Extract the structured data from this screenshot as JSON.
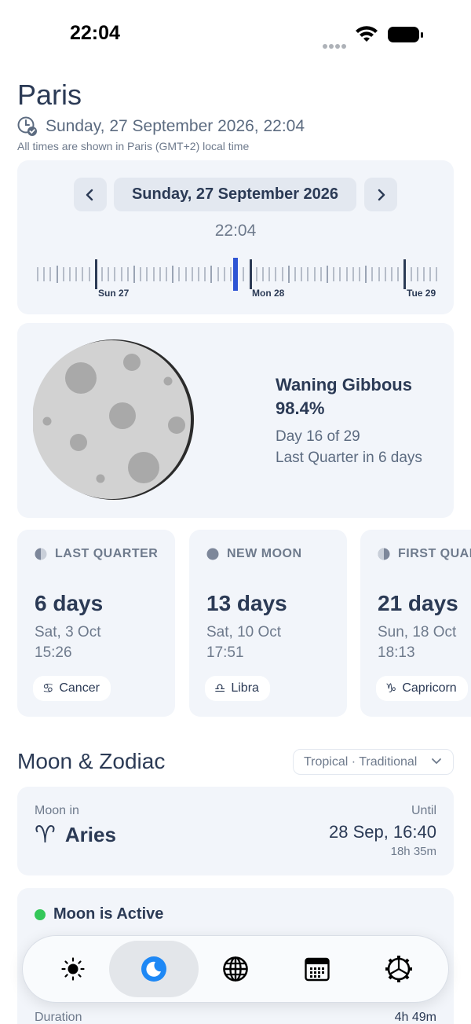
{
  "status_bar": {
    "time": "22:04"
  },
  "header": {
    "city": "Paris",
    "datetime": "Sunday, 27 September 2026, 22:04",
    "timezone_note": "All times are shown in Paris (GMT+2) local time"
  },
  "date_picker": {
    "date_label": "Sunday, 27 September 2026",
    "time_label": "22:04",
    "timeline_labels": [
      "Sun 27",
      "Mon 28",
      "Tue 29"
    ]
  },
  "moon": {
    "phase_name": "Waning Gibbous",
    "illumination": "98.4%",
    "day_of_cycle": "Day 16 of 29",
    "next_phase_note": "Last Quarter in 6 days"
  },
  "upcoming_phases": [
    {
      "name": "LAST QUARTER",
      "days": "6 days",
      "date": "Sat, 3 Oct",
      "time": "15:26",
      "zodiac_symbol": "♋",
      "zodiac": "Cancer"
    },
    {
      "name": "NEW MOON",
      "days": "13 days",
      "date": "Sat, 10 Oct",
      "time": "17:51",
      "zodiac_symbol": "♎",
      "zodiac": "Libra"
    },
    {
      "name": "FIRST QUARTER",
      "days": "21 days",
      "date": "Sun, 18 Oct",
      "time": "18:13",
      "zodiac_symbol": "♑",
      "zodiac": "Capricorn"
    }
  ],
  "zodiac_section": {
    "title": "Moon & Zodiac",
    "system": "Tropical · Traditional",
    "moon_in_label": "Moon in",
    "sign_symbol": "♈",
    "sign": "Aries",
    "until_label": "Until",
    "until_date": "28 Sep, 16:40",
    "until_remaining": "18h 35m"
  },
  "active_section": {
    "title": "Moon is Active",
    "duration_label": "Duration",
    "duration_value": "4h 49m"
  },
  "tabbar": {
    "tabs": [
      "sun",
      "moon",
      "globe",
      "calendar",
      "settings"
    ],
    "active": "moon"
  },
  "colors": {
    "primary_text": "#2b3a55",
    "card_background": "#f2f5fa",
    "accent_blue": "#1e88f5",
    "active_green": "#34c759",
    "timeline_now": "#2f55d4"
  }
}
